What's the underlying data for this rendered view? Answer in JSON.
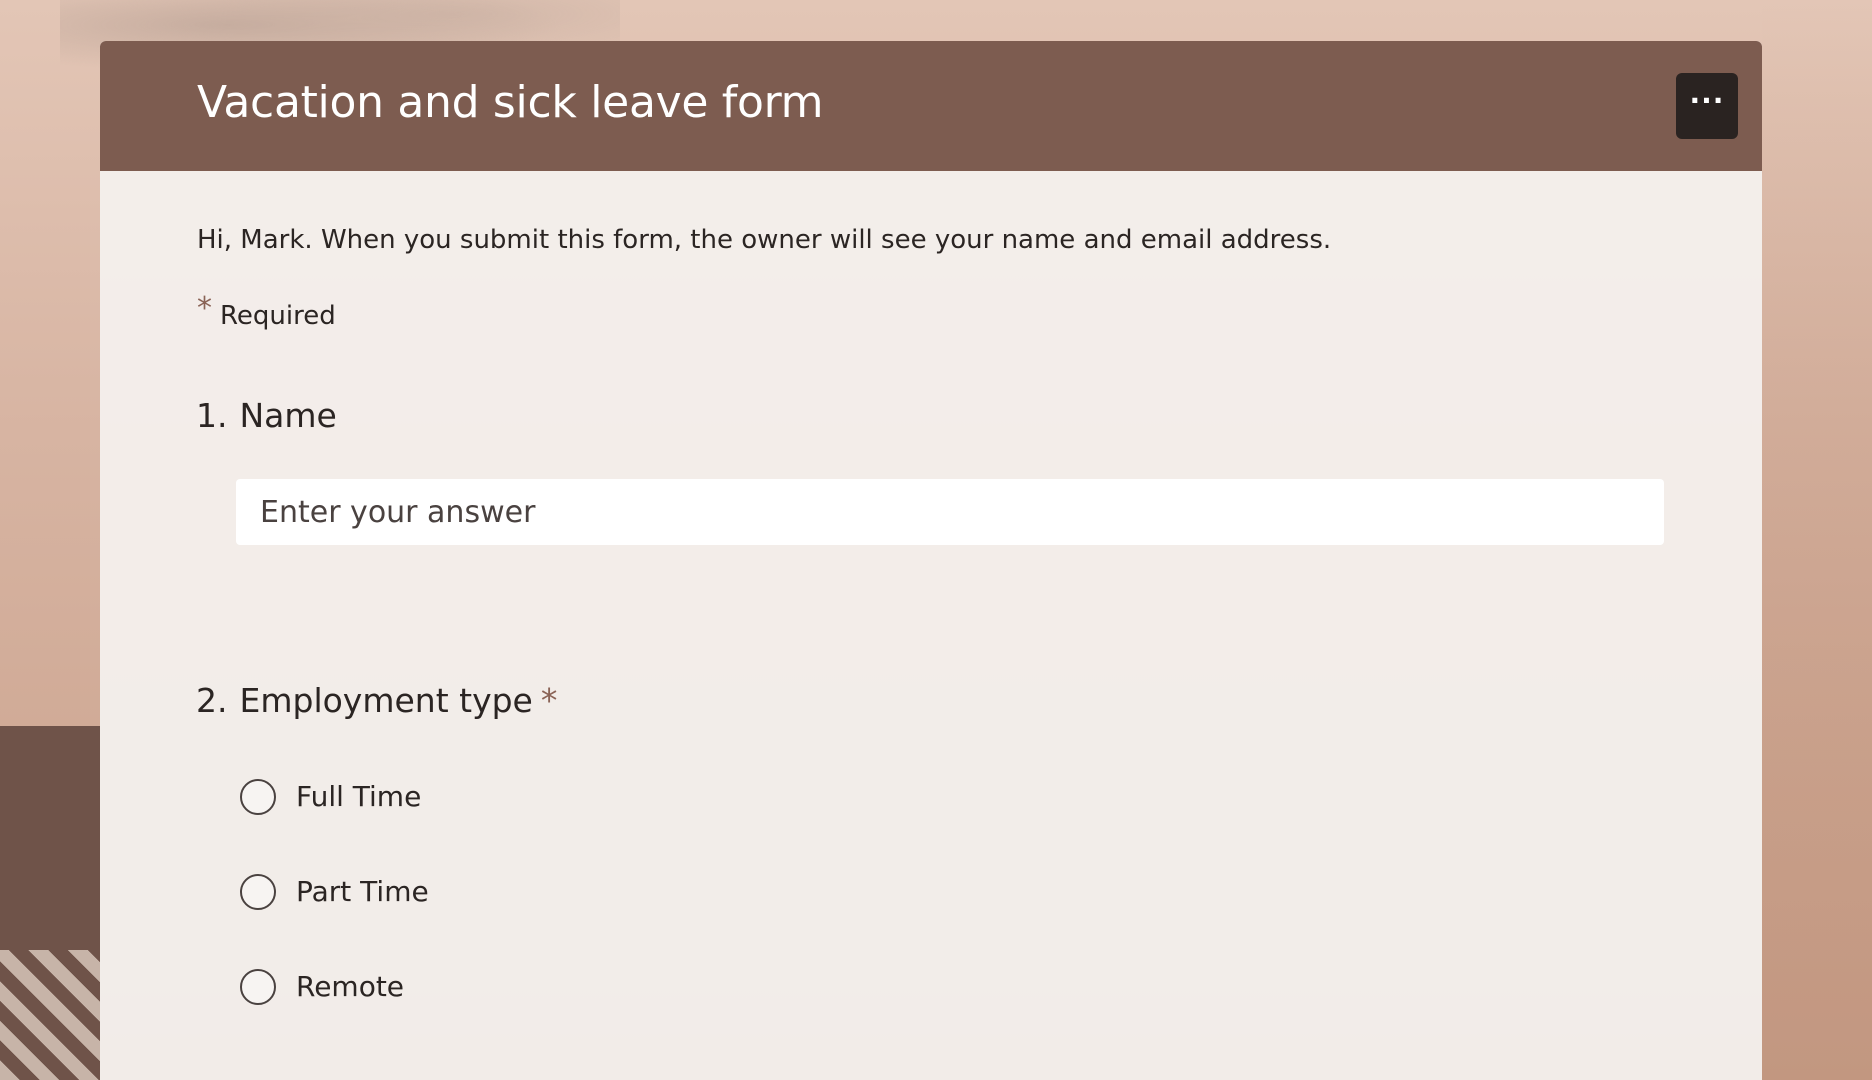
{
  "form": {
    "title": "Vacation and sick leave form",
    "more_options_label": "···",
    "intro": "Hi, Mark. When you submit this form, the owner will see your name and email address.",
    "required_marker": "*",
    "required_label": "Required"
  },
  "questions": [
    {
      "number": "1.",
      "title": "Name",
      "required": false,
      "input": {
        "placeholder": "Enter your answer",
        "value": ""
      }
    },
    {
      "number": "2.",
      "title": "Employment type",
      "required": true,
      "required_marker": "*",
      "options": [
        {
          "label": "Full Time",
          "selected": false
        },
        {
          "label": "Part Time",
          "selected": false
        },
        {
          "label": "Remote",
          "selected": false
        }
      ]
    }
  ],
  "colors": {
    "header_bg": "#7d5c50",
    "accent": "#8a6356",
    "more_button_bg": "#2a2321"
  }
}
